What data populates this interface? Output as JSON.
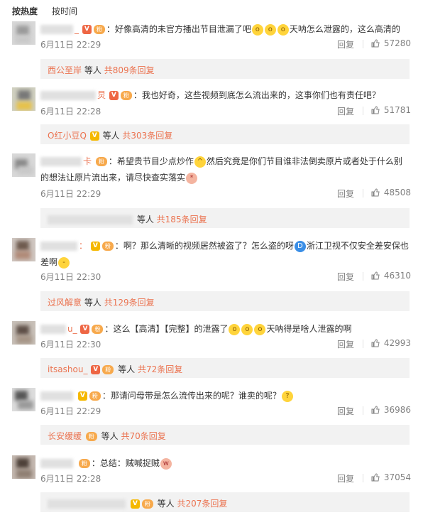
{
  "sort": {
    "hot": "按热度",
    "time": "按时间"
  },
  "comments": [
    {
      "name_tail": "_",
      "text1": "：好像高清的未官方播出节目泄漏了吧",
      "text2": "天呐怎么泄露的，这么高清的",
      "time": "6月11日 22:29",
      "reply": "回复",
      "likes": "57280",
      "sub": {
        "name": "西公至岸",
        "mid": "等人",
        "count": "共809条回复"
      }
    },
    {
      "name_tail": "炅",
      "text1": "：我也好奇，这些视频到底怎么流出来的，这事你们也有责任吧？",
      "time": "6月11日 22:28",
      "reply": "回复",
      "likes": "51781",
      "sub": {
        "name": "O红小豆Q",
        "mid": "等人",
        "count": "共303条回复"
      }
    },
    {
      "name_tail": "卡",
      "text1": "希望贵节目少点炒作",
      "text1b": "然后究竟是你们节目谁非法倒卖原片或者处于什么别",
      "text2": "的想法让原片流出来，请尽快查实落实",
      "time": "6月11日 22:29",
      "reply": "回复",
      "likes": "48508",
      "sub": {
        "name": "",
        "mid": "等人",
        "count": "共185条回复"
      }
    },
    {
      "name_tail": "：",
      "text1": "：啊？那么清晰的视频居然被盗了？怎么盗的呀",
      "text1b": "浙江卫视不仅安全差安保也",
      "text2": "差啊",
      "time": "6月11日 22:30",
      "reply": "回复",
      "likes": "46310",
      "sub": {
        "name": "过风解意",
        "mid": "等人",
        "count": "共129条回复"
      }
    },
    {
      "name_tail": "u_",
      "text1": "：这么【高清】【完整】的泄露了",
      "text1b": "天呐得是啥人泄露的啊",
      "time": "6月11日 22:30",
      "reply": "回复",
      "likes": "42993",
      "sub": {
        "name": "itsashou_",
        "mid": "等人",
        "count": "共72条回复"
      }
    },
    {
      "name_tail": "",
      "text1": "：那请问母带是怎么流传出来的呢？谁卖的呢？",
      "time": "6月11日 22:29",
      "reply": "回复",
      "likes": "36986",
      "sub": {
        "name": "长安缓缓",
        "mid": "等人",
        "count": "共70条回复"
      }
    },
    {
      "name_tail": "",
      "text1": "：总结：贼喊捉贼",
      "time": "6月11日 22:28",
      "reply": "回复",
      "likes": "37054",
      "sub": {
        "name": "",
        "mid": "等人",
        "count": "共207条回复"
      }
    }
  ],
  "colors": {
    "link": "#eb7350",
    "meta": "#808080",
    "subbg": "#f2f2f2"
  },
  "icons": [
    "thumb-up-icon",
    "vip-badge-icon",
    "fans-badge-icon",
    "emoji-icon"
  ]
}
